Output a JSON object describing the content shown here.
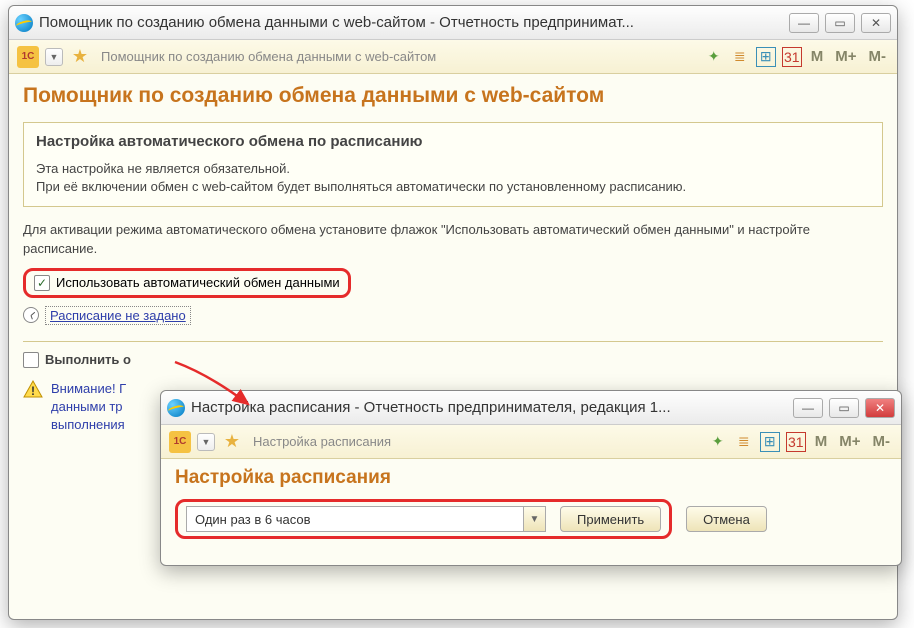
{
  "main_window": {
    "title": "Помощник по созданию обмена данными с web-сайтом - Отчетность предпринимат...",
    "toolbar_path": "Помощник по созданию обмена данными с web-сайтом",
    "toolbar": {
      "m": "M",
      "m_plus": "M+",
      "m_minus": "M-"
    },
    "page_title": "Помощник по созданию обмена данными с web-сайтом",
    "section": {
      "heading": "Настройка автоматического обмена по расписанию",
      "line1": "Эта настройка не является обязательной.",
      "line2": "При её включении обмен с web-сайтом будет выполняться автоматически по установленному расписанию."
    },
    "activation_text": "Для активации режима автоматического обмена установите флажок \"Использовать автоматический обмен данными\" и настройте расписание.",
    "checkbox_label": "Использовать автоматический обмен данными",
    "schedule_link": "Расписание не задано",
    "execute_label": "Выполнить о",
    "warning_text": "Внимание! Г\nданными тр\nвыполнения"
  },
  "sub_window": {
    "title": "Настройка расписания - Отчетность предпринимателя, редакция 1...",
    "toolbar_path": "Настройка расписания",
    "toolbar": {
      "m": "M",
      "m_plus": "M+",
      "m_minus": "M-"
    },
    "heading": "Настройка расписания",
    "select_value": "Один раз в 6 часов",
    "apply_label": "Применить",
    "cancel_label": "Отмена"
  },
  "icons": {
    "cal": "31"
  }
}
